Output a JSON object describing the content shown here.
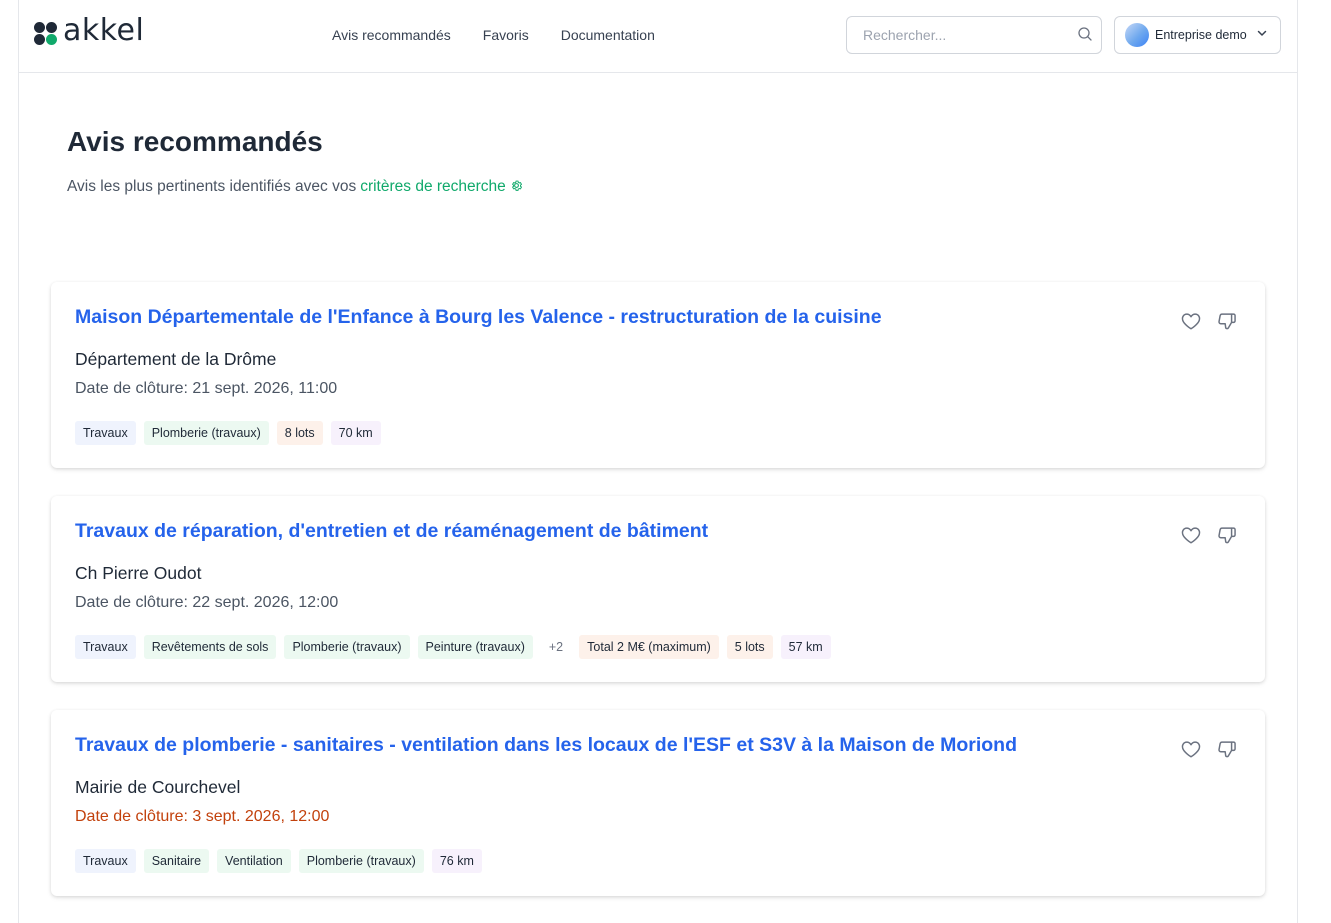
{
  "header": {
    "logo_text": "akkel",
    "logo_colors": [
      "#1f2937",
      "#1f2937",
      "#1f2937",
      "#10a96b"
    ],
    "nav": [
      {
        "label": "Avis recommandés"
      },
      {
        "label": "Favoris"
      },
      {
        "label": "Documentation"
      }
    ],
    "search": {
      "placeholder": "Rechercher...",
      "value": "",
      "icon": "search-icon"
    },
    "account": {
      "name": "Entreprise demo",
      "icon": "chevron-down-icon"
    }
  },
  "page": {
    "title": "Avis recommandés",
    "subtitle_prefix": "Avis les plus pertinents identifiés avec vos",
    "subtitle_link": "critères de recherche",
    "subtitle_icon": "gear-icon",
    "accent_color": "#10a96b",
    "link_color": "#2563eb",
    "urgent_color": "#c2410c"
  },
  "cards": [
    {
      "title": "Maison Départementale de l'Enfance à Bourg les Valence - restructuration de la cuisine",
      "org": "Département de la Drôme",
      "date": "Date de clôture: 21 sept. 2026, 11:00",
      "urgent": false,
      "tags": [
        {
          "label": "Travaux",
          "kind": "blue"
        },
        {
          "label": "Plomberie (travaux)",
          "kind": "green"
        },
        {
          "label": "8 lots",
          "kind": "orange"
        },
        {
          "label": "70 km",
          "kind": "purple"
        }
      ]
    },
    {
      "title": "Travaux de réparation, d'entretien et de réaménagement de bâtiment",
      "org": "Ch Pierre Oudot",
      "date": "Date de clôture: 22 sept. 2026, 12:00",
      "urgent": false,
      "tags": [
        {
          "label": "Travaux",
          "kind": "blue"
        },
        {
          "label": "Revêtements de sols",
          "kind": "green"
        },
        {
          "label": "Plomberie (travaux)",
          "kind": "green"
        },
        {
          "label": "Peinture (travaux)",
          "kind": "green"
        },
        {
          "label": "+2",
          "kind": "more"
        },
        {
          "label": "Total 2 M€ (maximum)",
          "kind": "orange"
        },
        {
          "label": "5 lots",
          "kind": "orange"
        },
        {
          "label": "57 km",
          "kind": "purple"
        }
      ]
    },
    {
      "title": "Travaux de plomberie - sanitaires - ventilation dans les locaux de l'ESF et S3V à la Maison de Moriond",
      "org": "Mairie de Courchevel",
      "date": "Date de clôture: 3 sept. 2026, 12:00",
      "urgent": true,
      "tags": [
        {
          "label": "Travaux",
          "kind": "blue"
        },
        {
          "label": "Sanitaire",
          "kind": "green"
        },
        {
          "label": "Ventilation",
          "kind": "green"
        },
        {
          "label": "Plomberie (travaux)",
          "kind": "green"
        },
        {
          "label": "76 km",
          "kind": "purple"
        }
      ]
    }
  ]
}
